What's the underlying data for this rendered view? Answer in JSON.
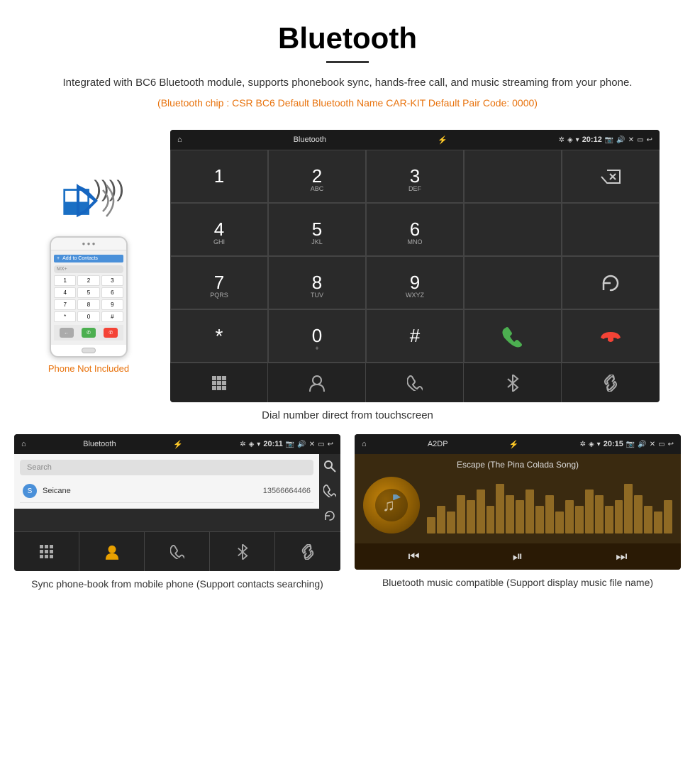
{
  "header": {
    "title": "Bluetooth",
    "description": "Integrated with BC6 Bluetooth module, supports phonebook sync, hands-free call, and music streaming from your phone.",
    "specs": "(Bluetooth chip : CSR BC6    Default Bluetooth Name CAR-KIT    Default Pair Code: 0000)"
  },
  "phone_illustration": {
    "not_included_label": "Phone Not Included"
  },
  "android_dial": {
    "status_bar": {
      "title": "Bluetooth",
      "time": "20:12"
    },
    "keys": [
      {
        "main": "1",
        "sub": ""
      },
      {
        "main": "2",
        "sub": "ABC"
      },
      {
        "main": "3",
        "sub": "DEF"
      },
      {
        "main": "",
        "sub": ""
      },
      {
        "main": "⌫",
        "sub": ""
      },
      {
        "main": "4",
        "sub": "GHI"
      },
      {
        "main": "5",
        "sub": "JKL"
      },
      {
        "main": "6",
        "sub": "MNO"
      },
      {
        "main": "",
        "sub": ""
      },
      {
        "main": "",
        "sub": ""
      },
      {
        "main": "7",
        "sub": "PQRS"
      },
      {
        "main": "8",
        "sub": "TUV"
      },
      {
        "main": "9",
        "sub": "WXYZ"
      },
      {
        "main": "",
        "sub": ""
      },
      {
        "main": "↺",
        "sub": ""
      },
      {
        "main": "*",
        "sub": ""
      },
      {
        "main": "0",
        "sub": "+"
      },
      {
        "main": "#",
        "sub": ""
      },
      {
        "main": "✆",
        "sub": "green"
      },
      {
        "main": "✆",
        "sub": "red"
      }
    ],
    "bottom_icons": [
      "⋮⋮⋮",
      "👤",
      "✆",
      "✲",
      "🔗"
    ]
  },
  "dial_caption": "Dial number direct from touchscreen",
  "phonebook": {
    "status_bar": {
      "title": "Bluetooth",
      "time": "20:11"
    },
    "search_placeholder": "Search",
    "contacts": [
      {
        "letter": "S",
        "name": "Seicane",
        "number": "13566664466"
      }
    ],
    "right_icons": [
      "🔍",
      "✆",
      "↺"
    ],
    "bottom_icons": [
      "⋮⋮⋮",
      "👤",
      "✆",
      "✲",
      "🔗"
    ]
  },
  "phonebook_caption": "Sync phone-book from mobile phone\n(Support contacts searching)",
  "music": {
    "status_bar": {
      "title": "A2DP",
      "time": "20:15"
    },
    "song_title": "Escape (The Pina Colada Song)",
    "visualizer_bars": [
      3,
      5,
      4,
      7,
      6,
      8,
      5,
      9,
      7,
      6,
      8,
      5,
      7,
      4,
      6,
      5,
      8,
      7,
      5,
      6,
      9,
      7,
      5,
      4,
      6
    ],
    "controls": [
      "⏮",
      "⏯",
      "⏭"
    ]
  },
  "music_caption": "Bluetooth music compatible\n(Support display music file name)"
}
